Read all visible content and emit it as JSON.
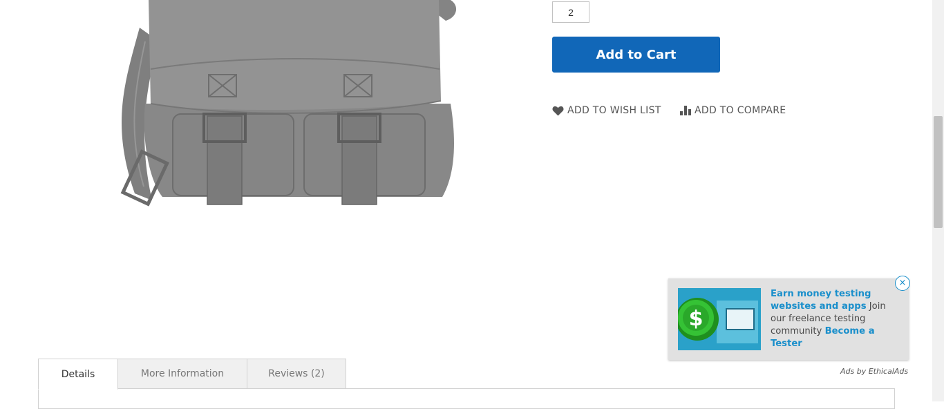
{
  "product": {
    "image_alt": "Gray leather messenger bag",
    "qty_value": "2",
    "add_to_cart_label": "Add to Cart",
    "wish_list_label": "Add to Wish List",
    "compare_label": "Add to Compare"
  },
  "ad": {
    "headline": "Earn money testing websites and apps",
    "body": " Join our freelance testing community ",
    "cta": "Become a Tester",
    "close_symbol": "×",
    "attribution": "Ads by EthicalAds"
  },
  "tabs": [
    {
      "label": "Details",
      "active": true
    },
    {
      "label": "More Information",
      "active": false
    },
    {
      "label": "Reviews (2)",
      "active": false
    }
  ],
  "colors": {
    "primary_button": "#1167b8",
    "ad_link": "#1a8fcb",
    "bag": "#8d8d8d"
  }
}
